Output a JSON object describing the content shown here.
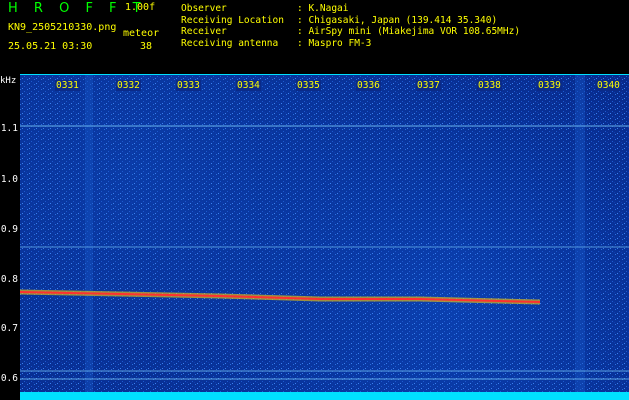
{
  "header": {
    "title": "H R O F F T",
    "version": "1.00f",
    "filename": "KN9_2505210330.png",
    "meteor_label": "meteor",
    "datetime": "25.05.21 03:30",
    "meteor_count": "38"
  },
  "meta": [
    {
      "label": "Observer",
      "value": ": K.Nagai"
    },
    {
      "label": "Receiving Location",
      "value": ": Chigasaki, Japan (139.414 35.340)"
    },
    {
      "label": "Receiver",
      "value": ": AirSpy mini (Miakejima VOR 108.65MHz)"
    },
    {
      "label": "Receiving antenna",
      "value": ": Maspro FM-3"
    }
  ],
  "y_axis": {
    "unit": "kHz",
    "ticks": [
      "1.1",
      "1.0",
      "0.9",
      "0.8",
      "0.7",
      "0.6"
    ]
  },
  "x_axis": {
    "ticks": [
      "0331",
      "0332",
      "0333",
      "0334",
      "0335",
      "0336",
      "0337",
      "0338",
      "0339",
      "0340"
    ]
  },
  "colors": {
    "background": "#072a8c",
    "trace": "#ff3030",
    "hline": "#7fd0ff",
    "baseline": "#00e0ff"
  }
}
